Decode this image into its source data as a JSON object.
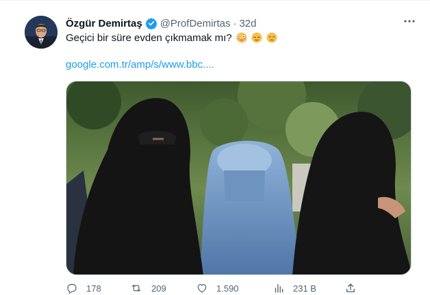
{
  "tweet": {
    "author_name": "Özgür Demirtaş",
    "author_handle": "@ProfDemirtas",
    "separator": "·",
    "time": "32d",
    "more_label": "···",
    "text": "Geçici bir süre evden çıkmamak mı?",
    "emojis": [
      "flushed-face-emoji",
      "relieved-face-emoji",
      "disappointed-face-emoji"
    ],
    "link": "google.com.tr/amp/s/www.bbc....",
    "media": {
      "subject": "women-in-veils-photo",
      "colors": {
        "black_veil": "#141414",
        "blue_burqa": "#6b8fb8",
        "foliage": "#4d6b3a"
      }
    }
  },
  "actions": {
    "reply_count": "178",
    "retweet_count": "209",
    "like_count": "1.590",
    "views_count": "231 B"
  },
  "colors": {
    "text": "#0f1419",
    "secondary": "#536471",
    "link": "#1d9bf0",
    "verified": "#1d9bf0",
    "border": "#cfd9de"
  }
}
